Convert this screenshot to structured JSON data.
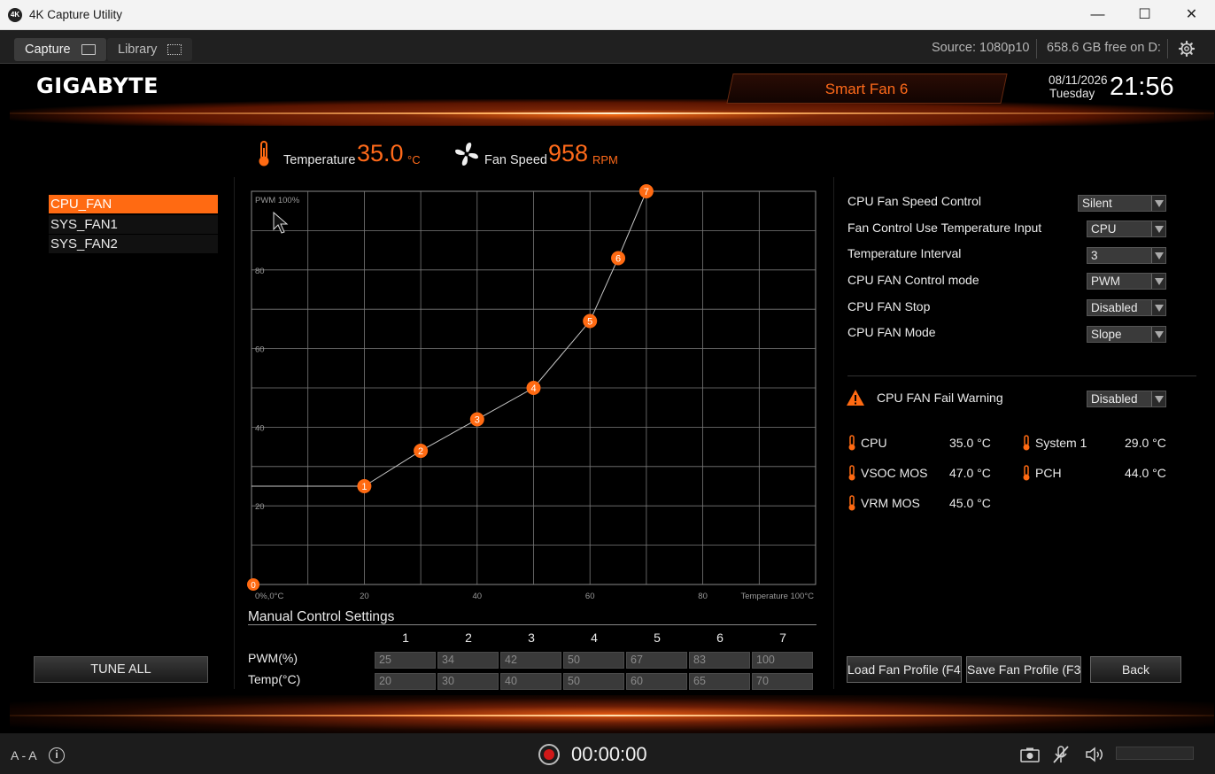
{
  "window": {
    "app_icon_text": "4K",
    "title": "4K Capture Utility",
    "minimize": "—",
    "maximize": "☐",
    "close": "✕"
  },
  "tabs": [
    {
      "label": "Capture",
      "active": true
    },
    {
      "label": "Library",
      "active": false
    }
  ],
  "status": {
    "source": "Source: 1080p10",
    "free_space": "658.6 GB free on D:"
  },
  "bios": {
    "logo": "GIGABYTE",
    "mode": "Smart Fan 6",
    "date": "08/11/2026",
    "day": "Tuesday",
    "time": "21:56",
    "temperature_label": "Temperature",
    "temperature_value": "35.0",
    "temperature_unit": "°C",
    "fan_speed_label": "Fan Speed",
    "fan_speed_value": "958",
    "fan_speed_unit": "RPM",
    "fans": [
      {
        "label": "CPU_FAN",
        "selected": true
      },
      {
        "label": "SYS_FAN1",
        "selected": false
      },
      {
        "label": "SYS_FAN2",
        "selected": false
      }
    ],
    "tune_all": "TUNE ALL",
    "chart_data": {
      "type": "line",
      "title": "",
      "y_top_label": "PWM 100%",
      "x_right_label": "Temperature 100°C",
      "origin_label": "0%,0°C",
      "origin_point_label": "0",
      "x_ticks": [
        "20",
        "40",
        "60",
        "80"
      ],
      "y_ticks": [
        "20",
        "40",
        "60",
        "80"
      ],
      "xlim": [
        0,
        100
      ],
      "ylim": [
        0,
        100
      ],
      "grid": true,
      "points": [
        {
          "n": "1",
          "x": 20,
          "y": 25
        },
        {
          "n": "2",
          "x": 30,
          "y": 34
        },
        {
          "n": "3",
          "x": 40,
          "y": 42
        },
        {
          "n": "4",
          "x": 50,
          "y": 50
        },
        {
          "n": "5",
          "x": 60,
          "y": 67
        },
        {
          "n": "6",
          "x": 65,
          "y": 83
        },
        {
          "n": "7",
          "x": 70,
          "y": 100
        }
      ],
      "line_color": "#c8c8c8",
      "point_color": "#ff6a12"
    },
    "manual": {
      "title": "Manual Control Settings",
      "columns": [
        "1",
        "2",
        "3",
        "4",
        "5",
        "6",
        "7"
      ],
      "pwm_label": "PWM(%)",
      "temp_label": "Temp(°C)",
      "pwm": [
        "25",
        "34",
        "42",
        "50",
        "67",
        "83",
        "100"
      ],
      "temp": [
        "20",
        "30",
        "40",
        "50",
        "60",
        "65",
        "70"
      ]
    },
    "settings": [
      {
        "label": "CPU Fan Speed Control",
        "value": "Silent"
      },
      {
        "label": "Fan Control Use Temperature Input",
        "value": "CPU"
      },
      {
        "label": "Temperature Interval",
        "value": "3"
      },
      {
        "label": "CPU FAN Control mode",
        "value": "PWM"
      },
      {
        "label": "CPU FAN Stop",
        "value": "Disabled"
      },
      {
        "label": "CPU FAN Mode",
        "value": "Slope"
      }
    ],
    "fail_warning": {
      "label": "CPU FAN Fail Warning",
      "value": "Disabled"
    },
    "sensors": [
      {
        "name": "CPU",
        "value": "35.0 °C"
      },
      {
        "name": "System 1",
        "value": "29.0 °C"
      },
      {
        "name": "VSOC MOS",
        "value": "47.0 °C"
      },
      {
        "name": "PCH",
        "value": "44.0 °C"
      },
      {
        "name": "VRM MOS",
        "value": "45.0 °C"
      }
    ],
    "buttons": {
      "load": "Load Fan Profile (F4)",
      "save": "Save Fan Profile (F3)",
      "back": "Back"
    }
  },
  "statusbar": {
    "aa": "A - A",
    "info": "i",
    "timer": "00:00:00"
  },
  "colors": {
    "accent": "#ff6a12",
    "bg": "#000000"
  }
}
